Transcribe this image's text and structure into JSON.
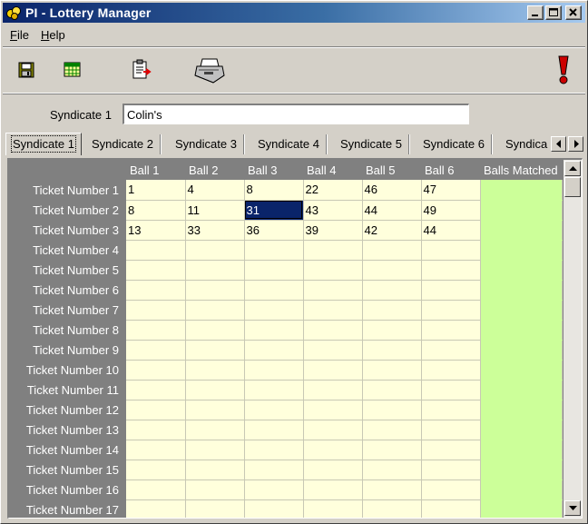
{
  "window": {
    "title": "PI - Lottery Manager"
  },
  "menu": {
    "file": {
      "mnemonic": "F",
      "rest": "ile"
    },
    "help": {
      "mnemonic": "H",
      "rest": "elp"
    }
  },
  "toolbar": {
    "icons": [
      "save-icon",
      "grid-icon",
      "clipboard-export-icon",
      "printer-icon",
      "alert-icon"
    ],
    "alert_color": "#cc0000"
  },
  "syndicate": {
    "label": "Syndicate 1",
    "name_value": "Colin's"
  },
  "tabs": [
    "Syndicate 1",
    "Syndicate 2",
    "Syndicate 3",
    "Syndicate 4",
    "Syndicate 5",
    "Syndicate 6",
    "Syndica"
  ],
  "active_tab": 0,
  "grid": {
    "columns": [
      "Ball 1",
      "Ball 2",
      "Ball 3",
      "Ball 4",
      "Ball 5",
      "Ball 6",
      "Balls Matched"
    ],
    "rows": [
      {
        "label": "Ticket Number 1",
        "balls": [
          "1",
          "4",
          "8",
          "22",
          "46",
          "47"
        ],
        "matched": ""
      },
      {
        "label": "Ticket Number 2",
        "balls": [
          "8",
          "11",
          "31",
          "43",
          "44",
          "49"
        ],
        "matched": ""
      },
      {
        "label": "Ticket Number 3",
        "balls": [
          "13",
          "33",
          "36",
          "39",
          "42",
          "44"
        ],
        "matched": ""
      },
      {
        "label": "Ticket Number 4",
        "balls": [
          "",
          "",
          "",
          "",
          "",
          ""
        ],
        "matched": ""
      },
      {
        "label": "Ticket Number 5",
        "balls": [
          "",
          "",
          "",
          "",
          "",
          ""
        ],
        "matched": ""
      },
      {
        "label": "Ticket Number 6",
        "balls": [
          "",
          "",
          "",
          "",
          "",
          ""
        ],
        "matched": ""
      },
      {
        "label": "Ticket Number 7",
        "balls": [
          "",
          "",
          "",
          "",
          "",
          ""
        ],
        "matched": ""
      },
      {
        "label": "Ticket Number 8",
        "balls": [
          "",
          "",
          "",
          "",
          "",
          ""
        ],
        "matched": ""
      },
      {
        "label": "Ticket Number 9",
        "balls": [
          "",
          "",
          "",
          "",
          "",
          ""
        ],
        "matched": ""
      },
      {
        "label": "Ticket Number 10",
        "balls": [
          "",
          "",
          "",
          "",
          "",
          ""
        ],
        "matched": ""
      },
      {
        "label": "Ticket Number 11",
        "balls": [
          "",
          "",
          "",
          "",
          "",
          ""
        ],
        "matched": ""
      },
      {
        "label": "Ticket Number 12",
        "balls": [
          "",
          "",
          "",
          "",
          "",
          ""
        ],
        "matched": ""
      },
      {
        "label": "Ticket Number 13",
        "balls": [
          "",
          "",
          "",
          "",
          "",
          ""
        ],
        "matched": ""
      },
      {
        "label": "Ticket Number 14",
        "balls": [
          "",
          "",
          "",
          "",
          "",
          ""
        ],
        "matched": ""
      },
      {
        "label": "Ticket Number 15",
        "balls": [
          "",
          "",
          "",
          "",
          "",
          ""
        ],
        "matched": ""
      },
      {
        "label": "Ticket Number 16",
        "balls": [
          "",
          "",
          "",
          "",
          "",
          ""
        ],
        "matched": ""
      },
      {
        "label": "Ticket Number 17",
        "balls": [
          "",
          "",
          "",
          "",
          "",
          ""
        ],
        "matched": ""
      }
    ],
    "selected": {
      "row": 1,
      "col": 2
    },
    "cell_color": "#ffffdc",
    "matched_color": "#ccff99",
    "header_color": "#808080"
  }
}
